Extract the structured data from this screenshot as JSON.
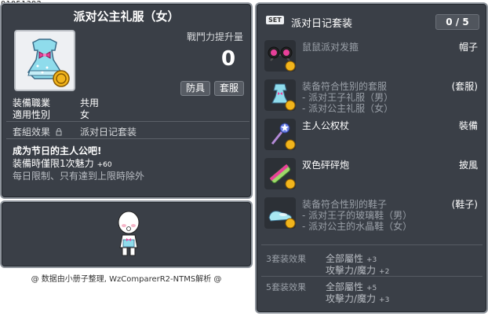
{
  "item_id": "01051392",
  "item": {
    "name": "派对公主礼服（女）",
    "power_label": "戰鬥力提升量",
    "power_value": "0",
    "tags": [
      "防具",
      "套服"
    ],
    "job_label": "装備職業",
    "job_value": "共用",
    "gender_label": "適用性別",
    "gender_value": "女",
    "set_label": "套組效果",
    "set_value": "派对日记套装",
    "desc_line1": "成为节日的主人公吧!",
    "desc_line2": "装備時僅限1次魅力",
    "desc_line2_bonus": "+60",
    "desc_line3": "每日限制、只有達到上限時除外"
  },
  "credit": "@ 数据由小册子整理, WzComparerR2-NTMS解析 @",
  "set_panel": {
    "badge": "SET",
    "name": "派对日记套装",
    "count": "0 / 5",
    "items": [
      {
        "name": "鼠鼠派对发箍",
        "slot": "帽子",
        "sub": [],
        "icon": "mouse-ear-headband-icon"
      },
      {
        "name": "装备符合性别的套服",
        "slot": "(套服)",
        "sub": [
          "- 派对王子礼服（男）",
          "- 派对公主礼服（女）"
        ],
        "icon": "party-dress-icon"
      },
      {
        "name": "主人公权杖",
        "slot": "裝備",
        "sub": [],
        "icon": "scepter-icon"
      },
      {
        "name": "双色砰砰炮",
        "slot": "披風",
        "sub": [],
        "icon": "party-cannon-icon"
      },
      {
        "name": "装备符合性别的鞋子",
        "slot": "(鞋子)",
        "sub": [
          "- 派对王子的玻璃鞋（男）",
          "- 派对公主的水晶鞋（女）"
        ],
        "icon": "glass-shoe-icon"
      }
    ],
    "bonuses": [
      {
        "level": "3套装效果",
        "stats": [
          {
            "label": "全部屬性",
            "value": "+3"
          },
          {
            "label": "攻擊力/魔力",
            "value": "+2"
          }
        ]
      },
      {
        "level": "5套装效果",
        "stats": [
          {
            "label": "全部屬性",
            "value": "+5"
          },
          {
            "label": "攻擊力/魔力",
            "value": "+3"
          }
        ]
      }
    ]
  }
}
